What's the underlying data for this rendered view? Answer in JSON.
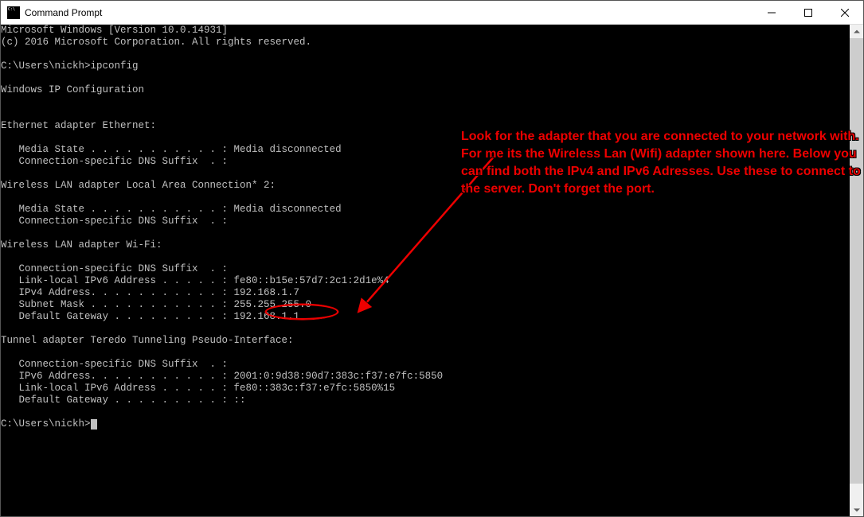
{
  "titlebar": {
    "title": "Command Prompt"
  },
  "annotation": {
    "text": "Look for the adapter that you are connected to your network with. For me its the Wireless Lan (Wifi) adapter shown here. Below you can find both the IPv4 and IPv6 Adresses. Use these to connect to the server. Don't forget the port."
  },
  "terminal": {
    "line_ms1": "Microsoft Windows [Version 10.0.14931]",
    "line_ms2": "(c) 2016 Microsoft Corporation. All rights reserved.",
    "prompt1_path": "C:\\Users\\nickh>",
    "prompt1_cmd": "ipconfig",
    "heading_ipconfig": "Windows IP Configuration",
    "eth_header": "Ethernet adapter Ethernet:",
    "eth_media": "   Media State . . . . . . . . . . . : Media disconnected",
    "eth_dns": "   Connection-specific DNS Suffix  . :",
    "wlan2_header": "Wireless LAN adapter Local Area Connection* 2:",
    "wlan2_media": "   Media State . . . . . . . . . . . : Media disconnected",
    "wlan2_dns": "   Connection-specific DNS Suffix  . :",
    "wifi_header": "Wireless LAN adapter Wi-Fi:",
    "wifi_dns": "   Connection-specific DNS Suffix  . :",
    "wifi_ipv6": "   Link-local IPv6 Address . . . . . : fe80::b15e:57d7:2c1:2d1e%4",
    "wifi_ipv4": "   IPv4 Address. . . . . . . . . . . : 192.168.1.7",
    "wifi_mask": "   Subnet Mask . . . . . . . . . . . : 255.255.255.0",
    "wifi_gw": "   Default Gateway . . . . . . . . . : 192.168.1.1",
    "teredo_header": "Tunnel adapter Teredo Tunneling Pseudo-Interface:",
    "teredo_dns": "   Connection-specific DNS Suffix  . :",
    "teredo_ipv6": "   IPv6 Address. . . . . . . . . . . : 2001:0:9d38:90d7:383c:f37:e7fc:5850",
    "teredo_ll": "   Link-local IPv6 Address . . . . . : fe80::383c:f37:e7fc:5850%15",
    "teredo_gw": "   Default Gateway . . . . . . . . . : ::",
    "prompt2_path": "C:\\Users\\nickh>"
  }
}
